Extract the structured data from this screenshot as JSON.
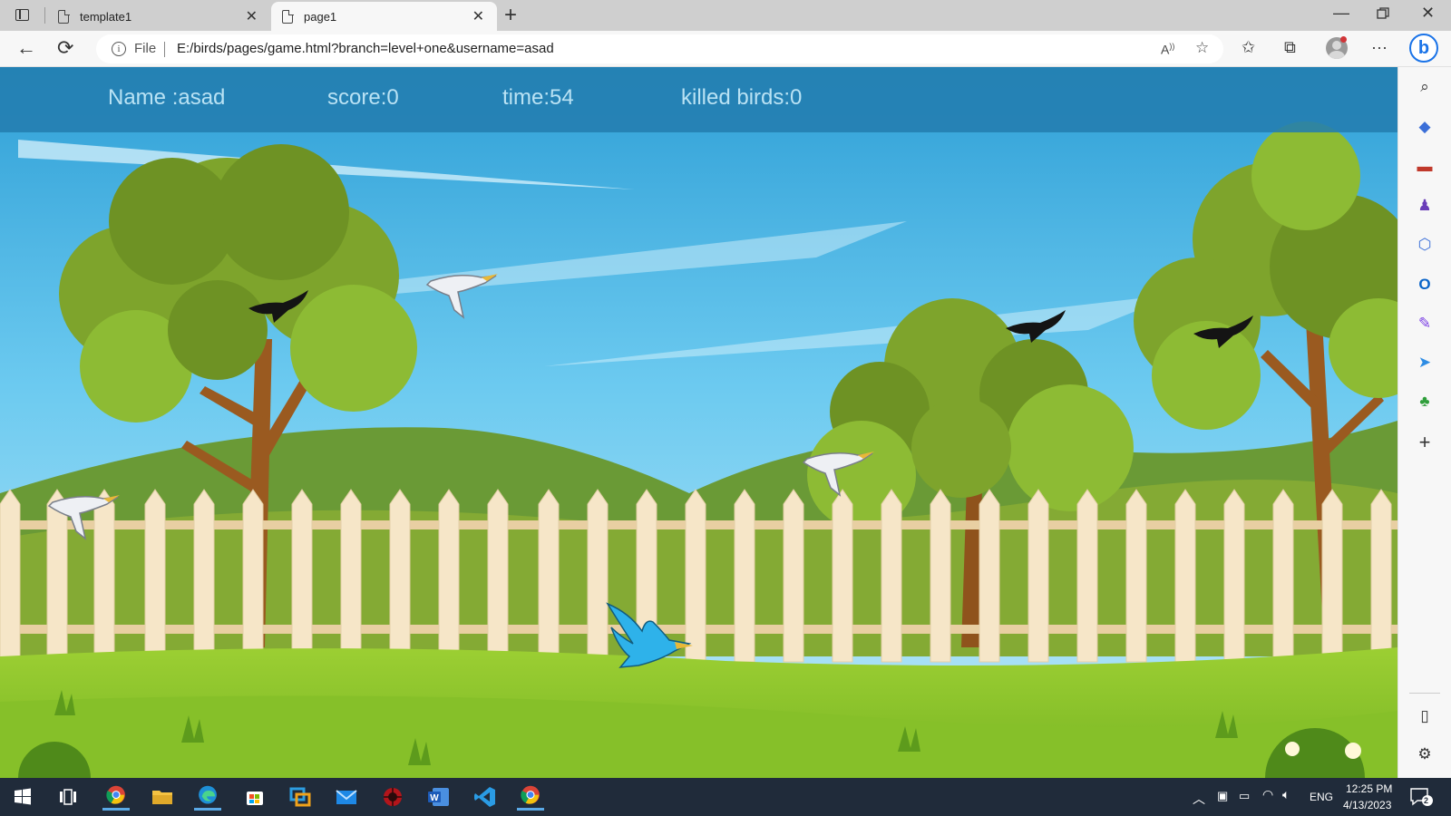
{
  "browser": {
    "tabs": [
      {
        "title": "template1",
        "active": false
      },
      {
        "title": "page1",
        "active": true
      }
    ],
    "address": {
      "scheme_label": "File",
      "url": "E:/birds/pages/game.html?branch=level+one&username=asad"
    }
  },
  "game": {
    "hud": {
      "name": "Name :asad",
      "score": "score:0",
      "time": "time:54",
      "killed": "killed birds:0"
    },
    "birds": [
      {
        "kind": "white-bird"
      },
      {
        "kind": "white-bird"
      },
      {
        "kind": "white-bird"
      },
      {
        "kind": "black-bird"
      },
      {
        "kind": "black-bird"
      },
      {
        "kind": "black-bird"
      },
      {
        "kind": "blue-bird",
        "role": "player"
      }
    ],
    "colors": {
      "sky": "#5fc3ec",
      "hud": "#237daf",
      "grass": "#7cbc2a",
      "fence": "#f6e6c8",
      "trunk": "#9a5a20",
      "foliage": "#7ea42c",
      "player_bird": "#2eb2ea"
    }
  },
  "taskbar": {
    "apps": [
      "start-icon",
      "task-view-icon",
      "chrome-icon",
      "file-explorer-icon",
      "edge-icon",
      "store-icon",
      "remote-icon",
      "mail-icon",
      "game-app-icon",
      "word-icon",
      "vscode-icon",
      "chrome-profile-icon"
    ],
    "tray": {
      "language": "ENG",
      "time": "12:25 PM",
      "date": "4/13/2023",
      "notifications": "2"
    }
  }
}
